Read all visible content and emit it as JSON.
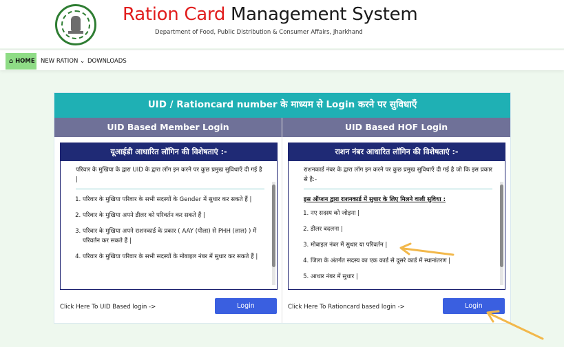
{
  "header": {
    "title_red": "Ration Card",
    "title_dark": "Management System",
    "subtitle": "Department of Food, Public Distribution & Consumer Affairs, Jharkhand"
  },
  "nav": {
    "home": "HOME",
    "new_ration": "NEW RATION",
    "downloads": "DOWNLOADS"
  },
  "panel": {
    "heading": "UID / Rationcard number के माध्यम से Login करने पर सुविधाएँ",
    "left": {
      "title": "UID Based Member Login",
      "box_title": "यूआईडी आधारित लॉगिन की विशेषताएं :-",
      "intro": "परिवार के मुखिया के द्वारा UID के द्वारा लॉग इन करने पर कुछ प्रमुख सुविधाएँ दी गई है |",
      "items": [
        "परिवार के मुखिया परिवार के सभी सदस्यों के Gender में सुधार कर सकते हैं |",
        "परिवार के मुखिया अपने डीलर को परिवर्तन कर सकते हैं |",
        "परिवार के मुखिया अपने राशनकार्ड के प्रकार ( AAY (पीला) से PHH (लाल) ) में परिवर्तन कर सकते हैं |",
        "परिवार के मुखिया परिवार के सभी सदस्यों के मोबाइल नंबर में सुधार कर सकते हैं |"
      ],
      "footer_text": "Click Here To UID Based login ->",
      "button": "Login"
    },
    "right": {
      "title": "UID Based HOF Login",
      "box_title": "राशन नंबर आधारित लॉगिन की विशेषताएं :-",
      "intro": "राशनकार्ड नंबर के द्वारा लॉग इन करने पर कुछ प्रमुख सुविधाएँ दी गई है जो कि इस प्रकार से है:-",
      "subheading": "इस ऑप्शन द्वारा राशनकार्ड में सुधार के लिए मिलने वाली सुविधा :",
      "items": [
        "नए सदस्य को जोड़ना |",
        "डीलर बदलना |",
        "मोबाइल नंबर में सुधार या परिवर्तन |",
        "जिला के अंतर्गत सदस्य का एक कार्ड से दूसरे कार्ड में स्थानांतरण |",
        "आधार नंबर में सुधार |"
      ],
      "footer_text": "Click Here To Rationcard based login ->",
      "button": "Login"
    }
  },
  "colors": {
    "brand_red": "#e11d1d",
    "teal_header": "#1fb0b4",
    "column_header": "#6f7198",
    "box_header": "#1f2a75",
    "button": "#3a5fe0",
    "annotation_arrow": "#f2b84b"
  },
  "icons": {
    "home": "home-icon",
    "dropdown": "chevron-down-icon",
    "logo": "jharkhand-emblem"
  }
}
